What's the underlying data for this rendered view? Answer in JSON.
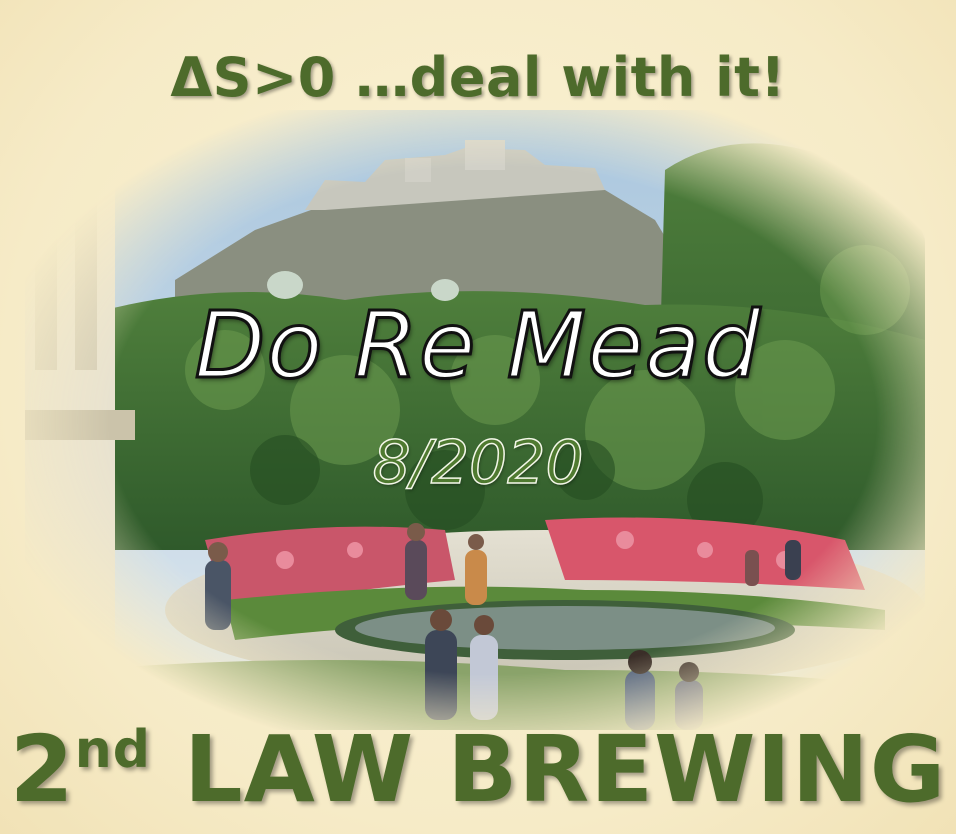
{
  "tagline": "ΔS>0 …deal with it!",
  "title": "Do Re Mead",
  "date": "8/2020",
  "brand": {
    "number": "2",
    "ordinal_suffix": "nd",
    "rest": " LAW BREWING"
  },
  "colors": {
    "background": "#f7edc9",
    "brand_green": "#4d6b2b",
    "date_green": "#4f7a30",
    "title_fill": "#ffffff",
    "title_outline": "#111111"
  }
}
